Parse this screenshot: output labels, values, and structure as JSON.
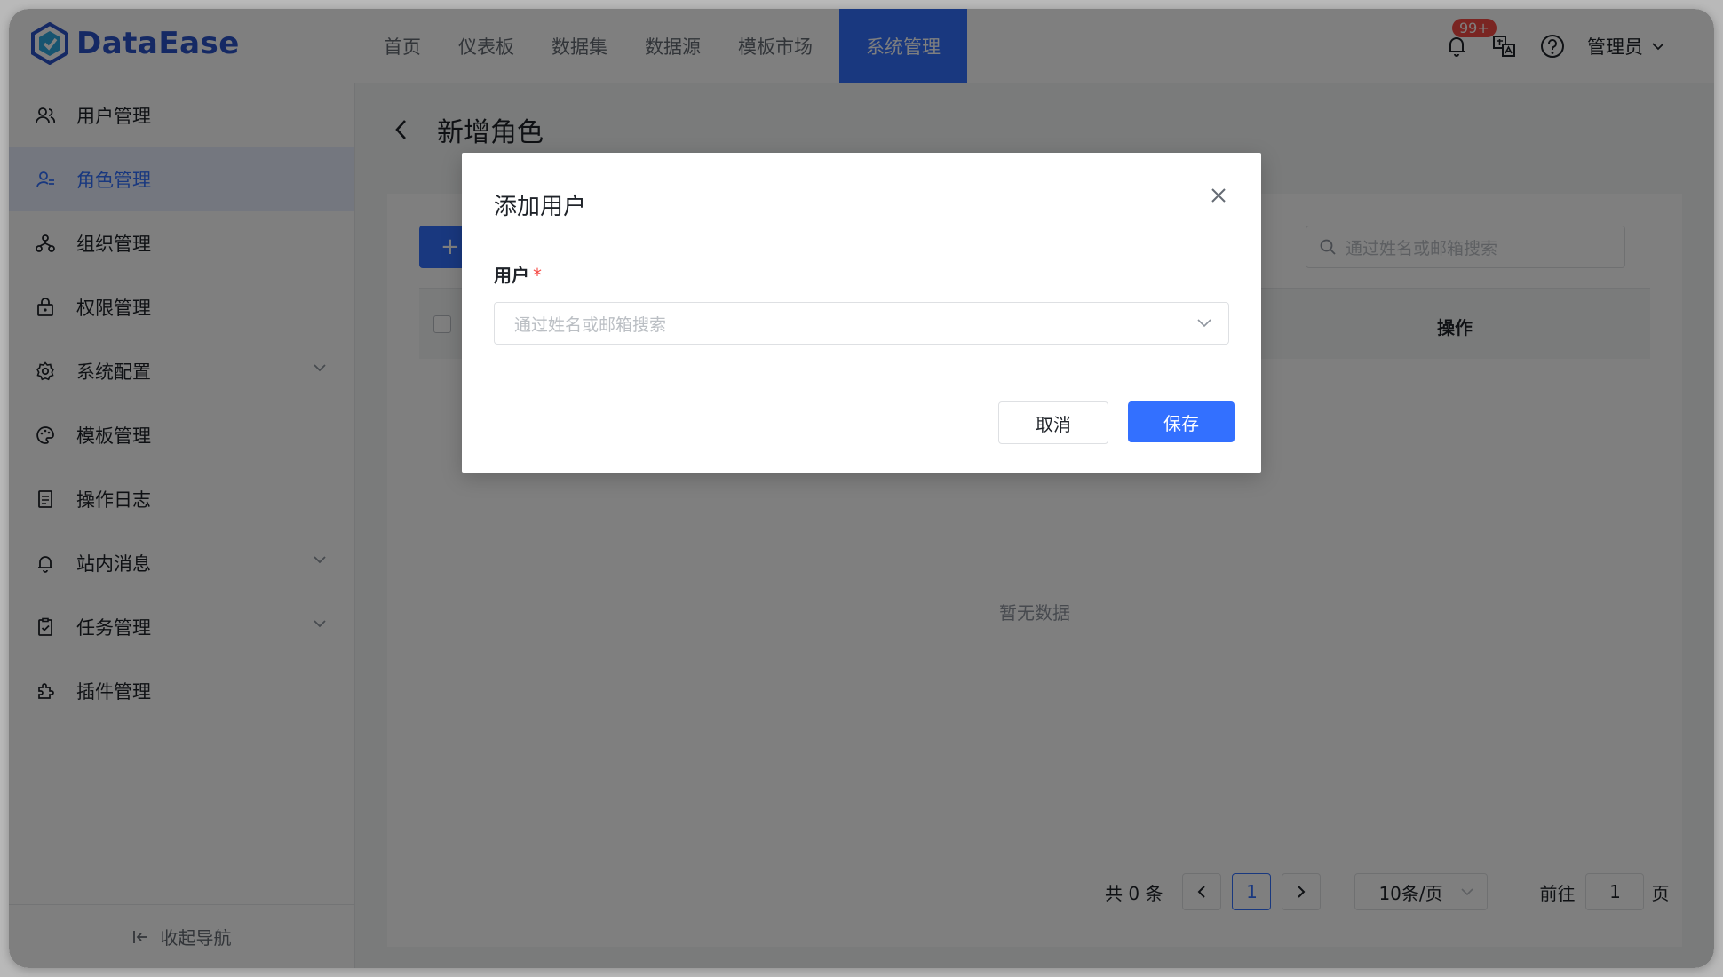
{
  "app": {
    "name": "DataEase",
    "brand_color": "#3370ff"
  },
  "header": {
    "nav": [
      {
        "label": "首页"
      },
      {
        "label": "仪表板"
      },
      {
        "label": "数据集"
      },
      {
        "label": "数据源"
      },
      {
        "label": "模板市场"
      },
      {
        "label": "系统管理",
        "active": true
      }
    ],
    "notification_badge": "99+",
    "user_name": "管理员"
  },
  "sidebar": {
    "items": [
      {
        "label": "用户管理",
        "icon": "users-icon"
      },
      {
        "label": "角色管理",
        "icon": "role-icon",
        "active": true
      },
      {
        "label": "组织管理",
        "icon": "org-icon"
      },
      {
        "label": "权限管理",
        "icon": "lock-icon"
      },
      {
        "label": "系统配置",
        "icon": "gear-icon",
        "expandable": true
      },
      {
        "label": "模板管理",
        "icon": "palette-icon"
      },
      {
        "label": "操作日志",
        "icon": "document-icon"
      },
      {
        "label": "站内消息",
        "icon": "bell-icon",
        "expandable": true
      },
      {
        "label": "任务管理",
        "icon": "clipboard-icon",
        "expandable": true
      },
      {
        "label": "插件管理",
        "icon": "plugin-icon"
      }
    ],
    "collapse_label": "收起导航"
  },
  "page": {
    "title": "新增角色",
    "add_button": "+",
    "search_placeholder": "通过姓名或邮箱搜索",
    "table": {
      "columns": [
        "操作"
      ],
      "rows": []
    },
    "empty_text": "暂无数据",
    "pagination": {
      "total_text": "共 0 条",
      "current_page": "1",
      "page_size": "10条/页",
      "goto_label": "前往",
      "goto_value": "1",
      "page_unit": "页"
    }
  },
  "dialog": {
    "title": "添加用户",
    "field_label": "用户",
    "required_mark": "*",
    "select_placeholder": "通过姓名或邮箱搜索",
    "cancel_label": "取消",
    "save_label": "保存"
  }
}
